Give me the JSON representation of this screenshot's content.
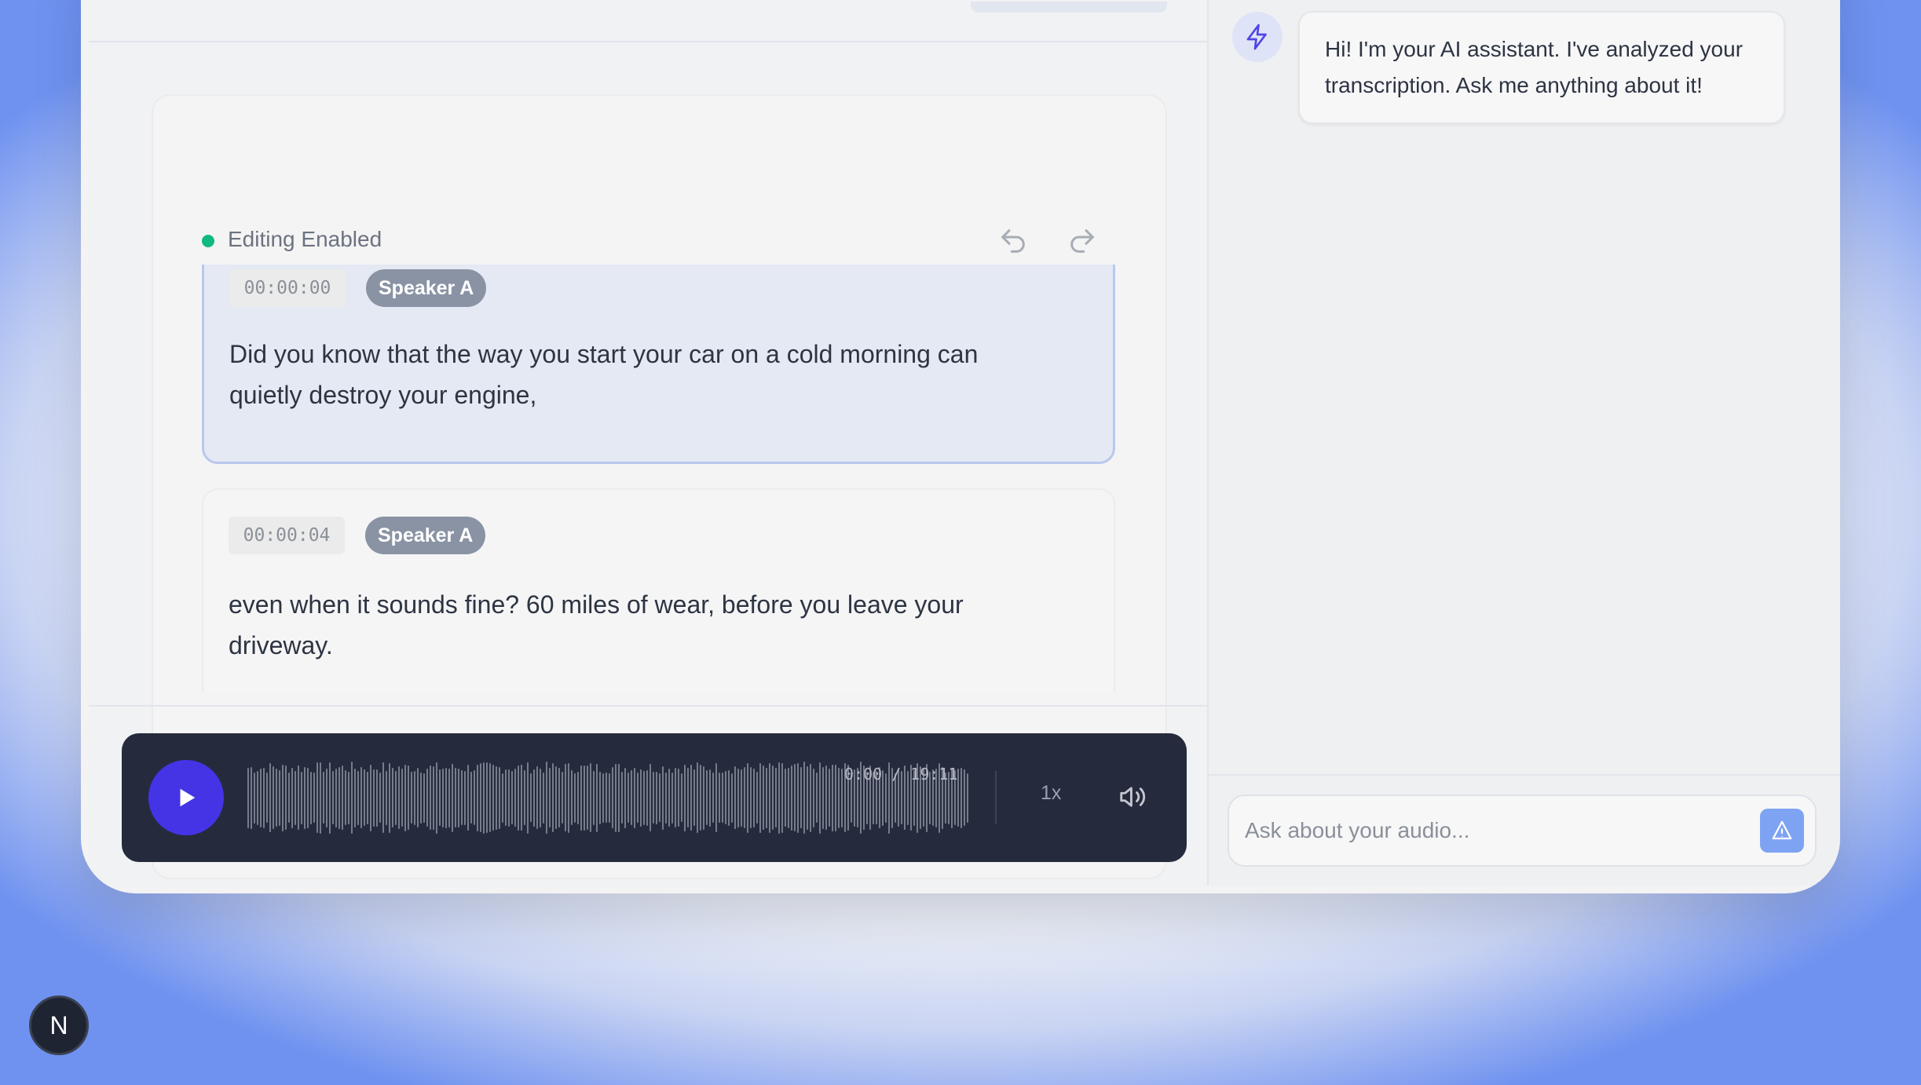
{
  "editor": {
    "status_label": "Editing Enabled",
    "undo_icon": "undo-icon",
    "redo_icon": "redo-icon"
  },
  "segments": [
    {
      "timestamp": "00:00:00",
      "speaker": "Speaker A",
      "text": "Did you know that the way you start your car on a cold morning can quietly destroy your engine,",
      "active": true
    },
    {
      "timestamp": "00:00:04",
      "speaker": "Speaker A",
      "text": "even when it sounds fine? 60 miles of wear, before you leave your driveway.",
      "active": false
    }
  ],
  "player": {
    "time": "0:00 / 19:11",
    "speed": "1x",
    "play_icon": "play-icon",
    "volume_icon": "volume-icon",
    "progress": 0
  },
  "chat": {
    "assistant_icon": "bolt-icon",
    "greeting": "Hi! I'm your AI assistant. I've analyzed your transcription. Ask me anything about it!",
    "input_placeholder": "Ask about your audio...",
    "send_icon": "send-icon"
  },
  "badge": {
    "letter": "N"
  },
  "colors": {
    "accent": "#4434e6",
    "status_green": "#10b981",
    "player_bg": "#252b3d",
    "send_button": "#7ea3f2"
  }
}
